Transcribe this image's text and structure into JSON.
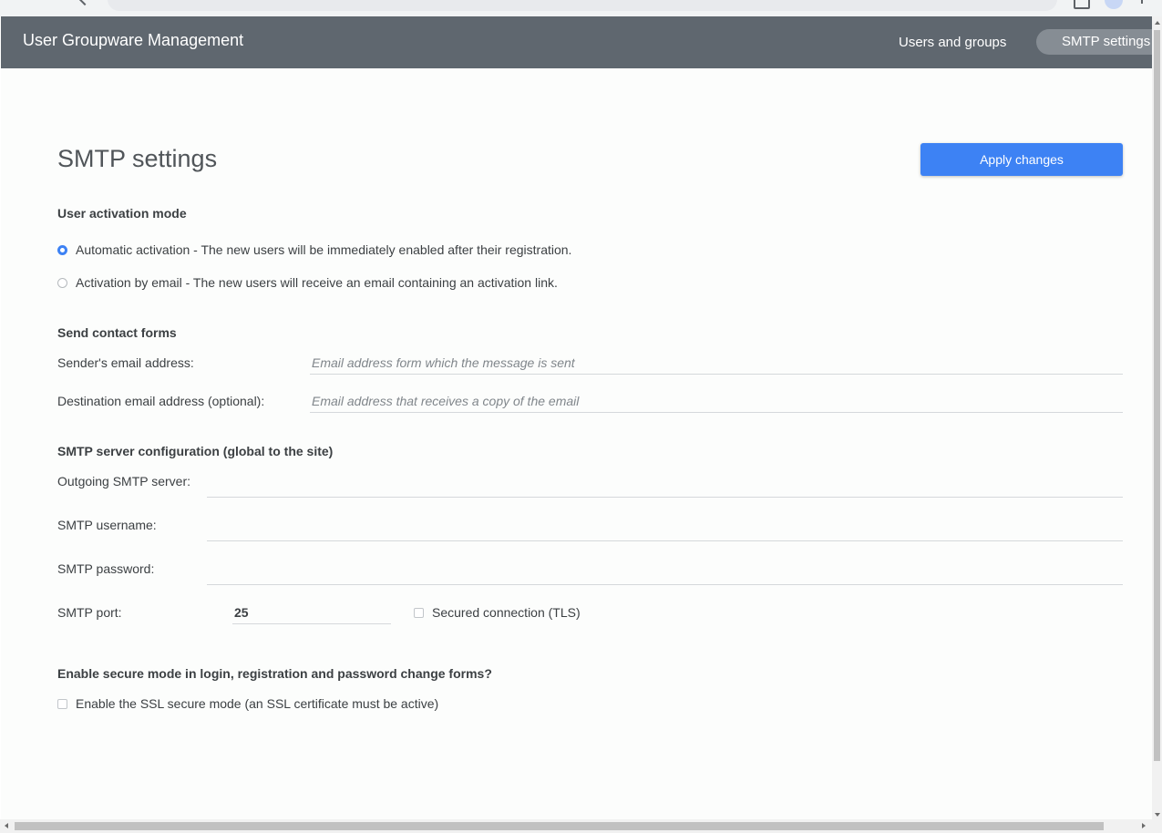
{
  "header": {
    "app_title": "User Groupware Management",
    "nav": {
      "users_groups": "Users and groups",
      "smtp_settings": "SMTP settings"
    }
  },
  "main": {
    "title": "SMTP settings",
    "apply_label": "Apply changes",
    "activation": {
      "heading": "User activation mode",
      "options": [
        {
          "label": "Automatic activation - The new users will be immediately enabled after their registration.",
          "selected": true
        },
        {
          "label": "Activation by email - The new users will receive an email containing an activation link.",
          "selected": false
        }
      ]
    },
    "contact": {
      "heading": "Send contact forms",
      "sender_label": "Sender's email address:",
      "sender_placeholder": "Email address form which the message is sent",
      "sender_value": "",
      "dest_label": "Destination email address (optional):",
      "dest_placeholder": "Email address that receives a copy of the email",
      "dest_value": ""
    },
    "smtp": {
      "heading": "SMTP server configuration (global to the site)",
      "server_label": "Outgoing SMTP server:",
      "server_value": "",
      "username_label": "SMTP username:",
      "username_value": "",
      "password_label": "SMTP password:",
      "password_value": "",
      "port_label": "SMTP port:",
      "port_value": "25",
      "tls_label": "Secured connection (TLS)",
      "tls_checked": false
    },
    "secure": {
      "heading": "Enable secure mode in login, registration and password change forms?",
      "ssl_label": "Enable the SSL secure mode (an SSL certificate must be active)",
      "ssl_checked": false
    }
  },
  "colors": {
    "header_bg": "#5f676f",
    "active_tab_bg": "#868d94",
    "accent": "#3d82f4"
  }
}
